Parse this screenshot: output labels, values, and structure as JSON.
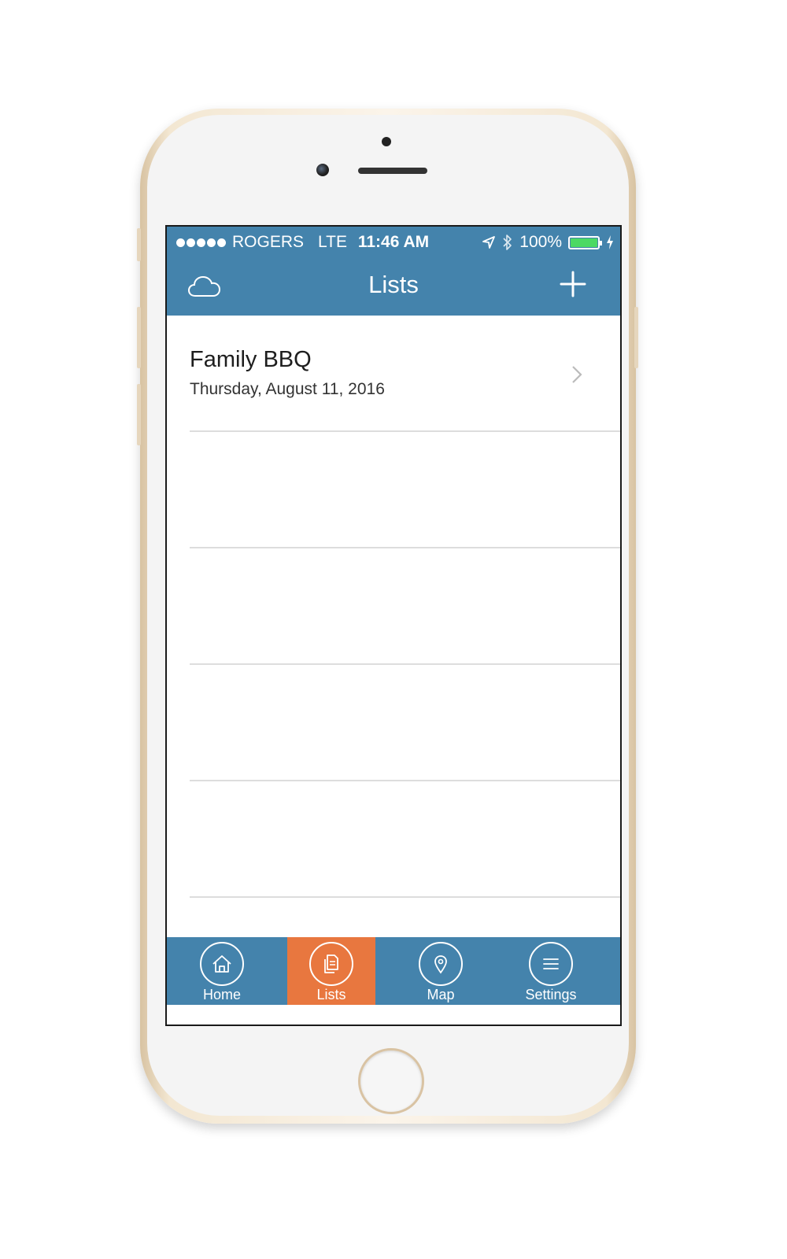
{
  "status_bar": {
    "carrier": "ROGERS",
    "network": "LTE",
    "time": "11:46 AM",
    "battery_percent": "100%",
    "battery_level": 1.0,
    "signal_bars": 5
  },
  "nav": {
    "title": "Lists",
    "left_icon": "cloud-icon",
    "right_icon": "plus-icon"
  },
  "lists": [
    {
      "title": "Family BBQ",
      "date": "Thursday, August 11, 2016"
    }
  ],
  "tabs": [
    {
      "label": "Home",
      "icon": "home-icon",
      "active": false
    },
    {
      "label": "Lists",
      "icon": "documents-icon",
      "active": true
    },
    {
      "label": "Map",
      "icon": "map-pin-icon",
      "active": false
    },
    {
      "label": "Settings",
      "icon": "menu-icon",
      "active": false
    }
  ],
  "colors": {
    "primary": "#4483ac",
    "accent": "#e8773f",
    "battery": "#4cd964",
    "separator": "#dddddd"
  }
}
